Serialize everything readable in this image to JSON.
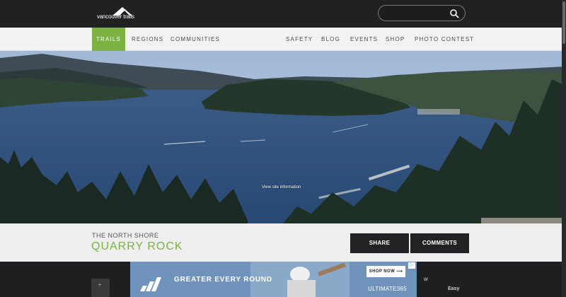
{
  "header": {
    "logo_text": "vancouver trails",
    "search": {
      "placeholder": ""
    }
  },
  "nav": {
    "left": [
      "TRAILS",
      "REGIONS",
      "COMMUNITIES"
    ],
    "right": [
      "SAFETY",
      "BLOG",
      "EVENTS",
      "SHOP",
      "PHOTO CONTEST"
    ],
    "active": "TRAILS",
    "accent_color": "#7bb241"
  },
  "hero": {
    "overlay_link": "View site information"
  },
  "trail": {
    "region": "THE NORTH SHORE",
    "name": "QUARRY ROCK"
  },
  "actions": {
    "share_label": "SHARE",
    "comments_label": "COMMENTS"
  },
  "ad": {
    "headline": "GREATER EVERY ROUND",
    "cta": "SHOP NOW ⟶",
    "product": "ULTIMATE365",
    "choice_mark": "▷",
    "side_mark": "ᴡ"
  },
  "trail_info": {
    "difficulty": "Easy"
  }
}
